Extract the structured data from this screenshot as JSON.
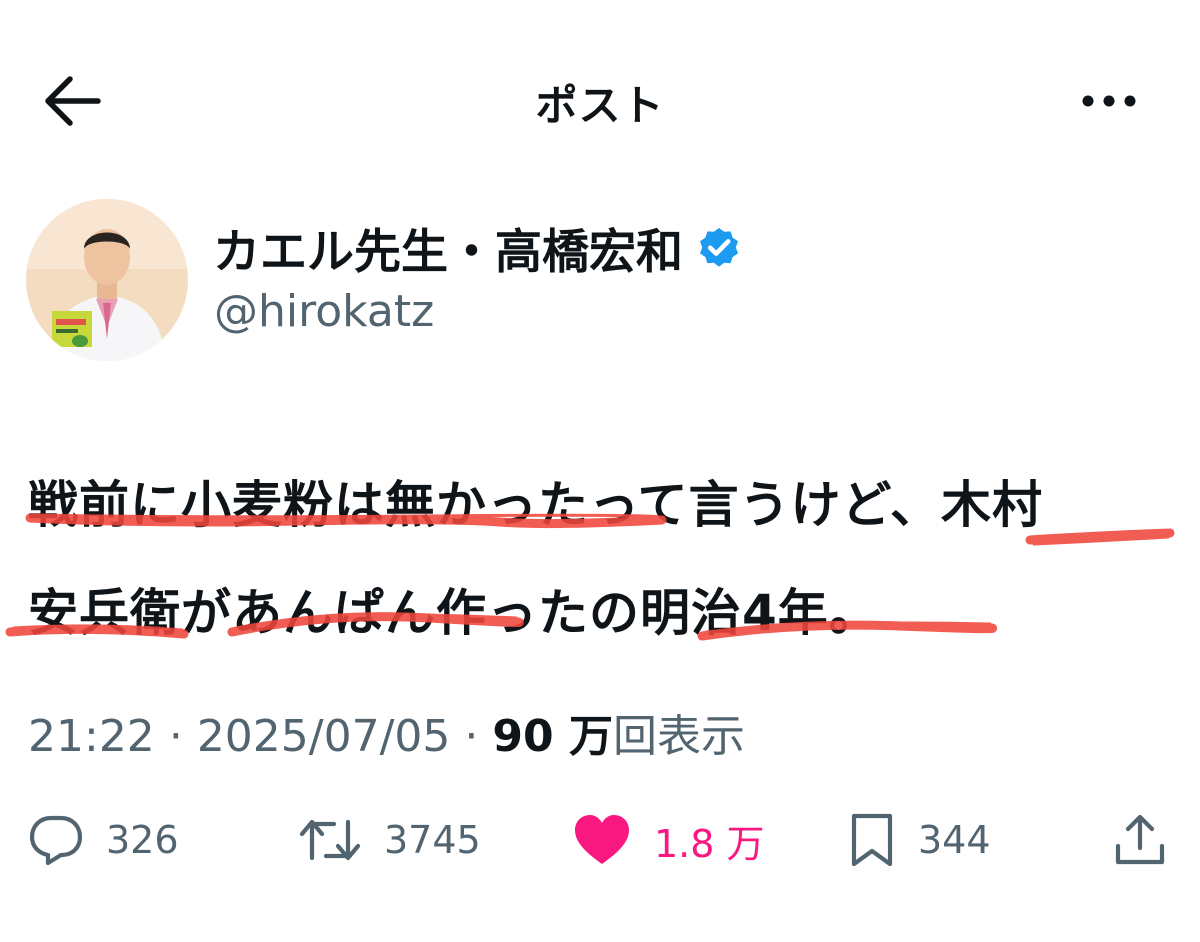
{
  "header": {
    "title": "ポスト",
    "back_icon": "arrow-left-icon",
    "more_icon": "more-horizontal-icon"
  },
  "author": {
    "display_name": "カエル先生・高橋宏和",
    "handle": "@hirokatz",
    "verified": true,
    "verified_color": "#1d9bf0"
  },
  "tweet": {
    "lines": [
      "戦前に小麦粉は無かったって言うけど、木村",
      "安兵衛があんぱん作ったの明治4年。"
    ]
  },
  "meta": {
    "time": "21:22",
    "separator": "·",
    "date": "2025/07/05",
    "views_count": "90 万",
    "views_label": "回表示"
  },
  "actions": {
    "replies": {
      "icon": "reply-icon",
      "count": "326"
    },
    "reposts": {
      "icon": "repost-icon",
      "count": "3745"
    },
    "likes": {
      "icon": "heart-icon",
      "count": "1.8 万",
      "color": "#f91880"
    },
    "bookmarks": {
      "icon": "bookmark-icon",
      "count": "344"
    },
    "share": {
      "icon": "share-icon"
    }
  },
  "colors": {
    "text": "#0f1419",
    "secondary_text": "#536471",
    "underline": "#f0463c"
  }
}
